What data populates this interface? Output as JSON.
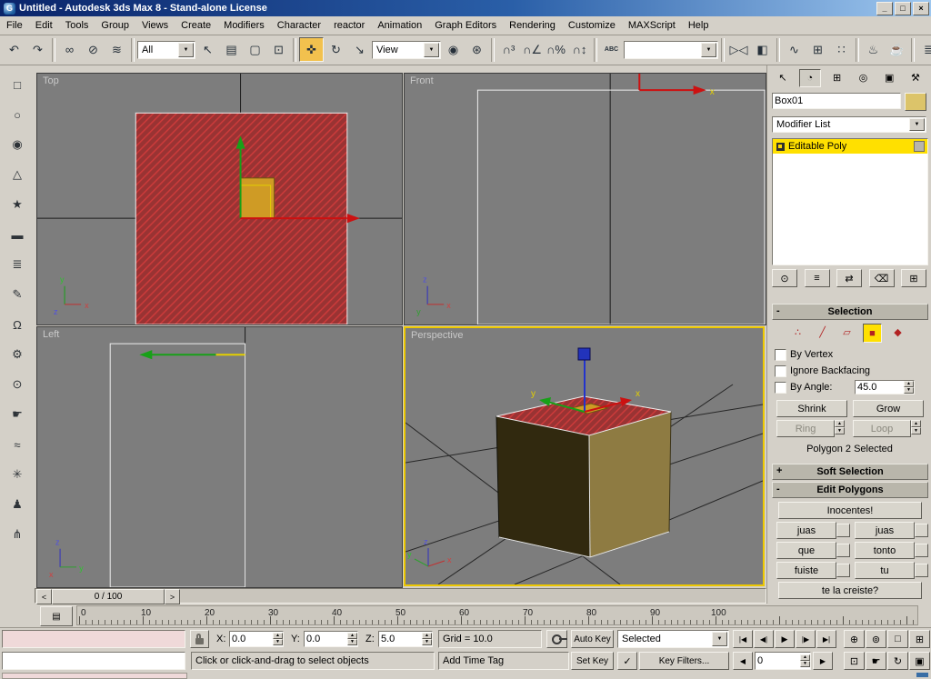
{
  "titlebar": {
    "title": "Untitled - Autodesk 3ds Max 8  - Stand-alone License",
    "app_initial": "G",
    "buttons": {
      "minimize": "_",
      "restore": "□",
      "close": "×"
    }
  },
  "menu": {
    "items": [
      "File",
      "Edit",
      "Tools",
      "Group",
      "Views",
      "Create",
      "Modifiers",
      "Character",
      "reactor",
      "Animation",
      "Graph Editors",
      "Rendering",
      "Customize",
      "MAXScript",
      "Help"
    ]
  },
  "toolbar": {
    "selection_filter": "All",
    "coord_system": "View",
    "named_selection": "",
    "buttons": [
      {
        "name": "undo",
        "glyph": "↶"
      },
      {
        "name": "redo",
        "glyph": "↷"
      },
      {
        "name": "select-and-link",
        "glyph": "∞"
      },
      {
        "name": "unlink-selection",
        "glyph": "⊘"
      },
      {
        "name": "bind-to-space-warp",
        "glyph": "≋"
      },
      {
        "name": "select-object",
        "glyph": "↖"
      },
      {
        "name": "select-by-name",
        "glyph": "▤"
      },
      {
        "name": "rectangular-selection-region",
        "glyph": "▢"
      },
      {
        "name": "window-crossing",
        "glyph": "⊡"
      },
      {
        "name": "select-and-move",
        "glyph": "✜"
      },
      {
        "name": "select-and-rotate",
        "glyph": "↻"
      },
      {
        "name": "select-and-scale",
        "glyph": "↘"
      },
      {
        "name": "use-pivot-point-center",
        "glyph": "◉"
      },
      {
        "name": "select-and-manipulate",
        "glyph": "⊛"
      },
      {
        "name": "snap-toggle-3d",
        "glyph": "∩³"
      },
      {
        "name": "angle-snap",
        "glyph": "∩∠"
      },
      {
        "name": "percent-snap",
        "glyph": "∩%"
      },
      {
        "name": "spinner-snap",
        "glyph": "∩↕"
      },
      {
        "name": "edit-named-selection-sets",
        "glyph": "ABC"
      },
      {
        "name": "mirror",
        "glyph": "▷◁"
      },
      {
        "name": "align",
        "glyph": "◧"
      },
      {
        "name": "curve-editor",
        "glyph": "∿"
      },
      {
        "name": "schematic-view",
        "glyph": "⊞"
      },
      {
        "name": "material-editor",
        "glyph": "∷"
      },
      {
        "name": "render-scene",
        "glyph": "♨"
      },
      {
        "name": "quick-render",
        "glyph": "☕"
      },
      {
        "name": "layer-manager",
        "glyph": "≣"
      }
    ]
  },
  "left_toolbar": {
    "icons": [
      {
        "name": "box-primitive",
        "glyph": "□"
      },
      {
        "name": "cylinder-primitive",
        "glyph": "○"
      },
      {
        "name": "sphere-primitive",
        "glyph": "◉"
      },
      {
        "name": "cone-primitive",
        "glyph": "△"
      },
      {
        "name": "star-shape",
        "glyph": "★"
      },
      {
        "name": "plane-primitive",
        "glyph": "▬"
      },
      {
        "name": "hose-primitive",
        "glyph": "≣"
      },
      {
        "name": "pencil-tool",
        "glyph": "✎"
      },
      {
        "name": "magnet-tool",
        "glyph": "Ω"
      },
      {
        "name": "gear-tool",
        "glyph": "⚙"
      },
      {
        "name": "pin-tool",
        "glyph": "⊙"
      },
      {
        "name": "hand-tool",
        "glyph": "☛"
      },
      {
        "name": "space-warp-tool",
        "glyph": "≈"
      },
      {
        "name": "spiral-tool",
        "glyph": "✳"
      },
      {
        "name": "biped-tool",
        "glyph": "♟"
      },
      {
        "name": "bones-tool",
        "glyph": "⋔"
      }
    ]
  },
  "viewports": {
    "top": {
      "label": "Top",
      "tripod": {
        "x": "x",
        "y": "y",
        "z": "z"
      }
    },
    "front": {
      "label": "Front",
      "gizmo_x": "x",
      "tripod": {
        "x": "x",
        "y": "y",
        "z": "z"
      }
    },
    "left": {
      "label": "Left",
      "tripod": {
        "x": "x",
        "y": "y",
        "z": "z"
      }
    },
    "perspective": {
      "label": "Perspective",
      "gizmo_x": "x",
      "gizmo_y": "y",
      "tripod": {
        "x": "x",
        "y": "y",
        "z": "z"
      }
    }
  },
  "trackbar": {
    "prev": "<",
    "value": "0 / 100",
    "next": ">"
  },
  "timeline": {
    "mini_icon": "▤",
    "labels": [
      "0",
      "10",
      "20",
      "30",
      "40",
      "50",
      "60",
      "70",
      "80",
      "90",
      "100"
    ]
  },
  "command_panel": {
    "tabs": [
      {
        "name": "create",
        "glyph": "↖"
      },
      {
        "name": "modify",
        "glyph": "◔"
      },
      {
        "name": "hierarchy",
        "glyph": "⊞"
      },
      {
        "name": "motion",
        "glyph": "◎"
      },
      {
        "name": "display",
        "glyph": "▣"
      },
      {
        "name": "utilities",
        "glyph": "⚒"
      }
    ],
    "object_name": "Box01",
    "modifier_list_label": "Modifier List",
    "stack": {
      "selected": "Editable Poly"
    },
    "stack_buttons": [
      {
        "name": "pin-stack",
        "glyph": "⊙"
      },
      {
        "name": "show-end-result",
        "glyph": "≡"
      },
      {
        "name": "make-unique",
        "glyph": "⇄"
      },
      {
        "name": "remove-modifier",
        "glyph": "⌫"
      },
      {
        "name": "configure-modifier-sets",
        "glyph": "⊞"
      }
    ],
    "selection": {
      "collapse": "-",
      "title": "Selection",
      "sub_objects": [
        {
          "name": "vertex",
          "glyph": "∴"
        },
        {
          "name": "edge",
          "glyph": "╱"
        },
        {
          "name": "border",
          "glyph": "▱"
        },
        {
          "name": "polygon",
          "glyph": "■"
        },
        {
          "name": "element",
          "glyph": "◆"
        }
      ],
      "by_vertex": "By Vertex",
      "ignore_backfacing": "Ignore Backfacing",
      "by_angle": "By Angle:",
      "angle_value": "45.0",
      "shrink": "Shrink",
      "grow": "Grow",
      "ring": "Ring",
      "loop": "Loop",
      "status": "Polygon 2 Selected"
    },
    "soft_selection": {
      "collapse": "+",
      "title": "Soft Selection"
    },
    "edit_polygons": {
      "collapse": "-",
      "title": "Edit Polygons",
      "top_button": "Inocentes!",
      "rows": [
        [
          "juas",
          "juas"
        ],
        [
          "que",
          "tonto"
        ],
        [
          "fuiste",
          "tu"
        ]
      ],
      "bottom_button": "te la creiste?"
    }
  },
  "status": {
    "coords": {
      "x_label": "X:",
      "x": "0.0",
      "y_label": "Y:",
      "y": "0.0",
      "z_label": "Z:",
      "z": "5.0"
    },
    "grid": "Grid = 10.0",
    "auto_key": "Auto Key",
    "set_key": "Set Key",
    "selected_dd": "Selected",
    "key_filters": "Key Filters...",
    "key_check": "✓",
    "prompt": "Click or click-and-drag to select objects",
    "add_time_tag": "Add Time Tag",
    "frame": "0",
    "prev_key": "◀",
    "next_key": "▶",
    "playback": [
      {
        "name": "go-to-start",
        "glyph": "|◀"
      },
      {
        "name": "previous-frame",
        "glyph": "◀|"
      },
      {
        "name": "play",
        "glyph": "▶"
      },
      {
        "name": "next-frame",
        "glyph": "|▶"
      },
      {
        "name": "go-to-end",
        "glyph": "▶|"
      }
    ],
    "nav_top": [
      {
        "name": "zoom",
        "glyph": "⊕"
      },
      {
        "name": "zoom-all",
        "glyph": "⊚"
      },
      {
        "name": "zoom-extents",
        "glyph": "□"
      },
      {
        "name": "zoom-extents-all",
        "glyph": "⊞"
      }
    ],
    "nav_bottom": [
      {
        "name": "region-zoom",
        "glyph": "⊡"
      },
      {
        "name": "pan",
        "glyph": "☛"
      },
      {
        "name": "arc-rotate",
        "glyph": "↻"
      },
      {
        "name": "min-max-toggle",
        "glyph": "▣"
      }
    ]
  },
  "colors": {
    "active_viewport_border": "#edc800",
    "selected_face_red": "#cc3b3b",
    "gizmo_x": "#cc1111",
    "gizmo_y": "#18a018",
    "gizmo_z": "#2233cc",
    "object_color_swatch": "#dcc46a",
    "stack_highlight": "#ffe000",
    "macro_recorder_bg": "#efd9d9"
  }
}
